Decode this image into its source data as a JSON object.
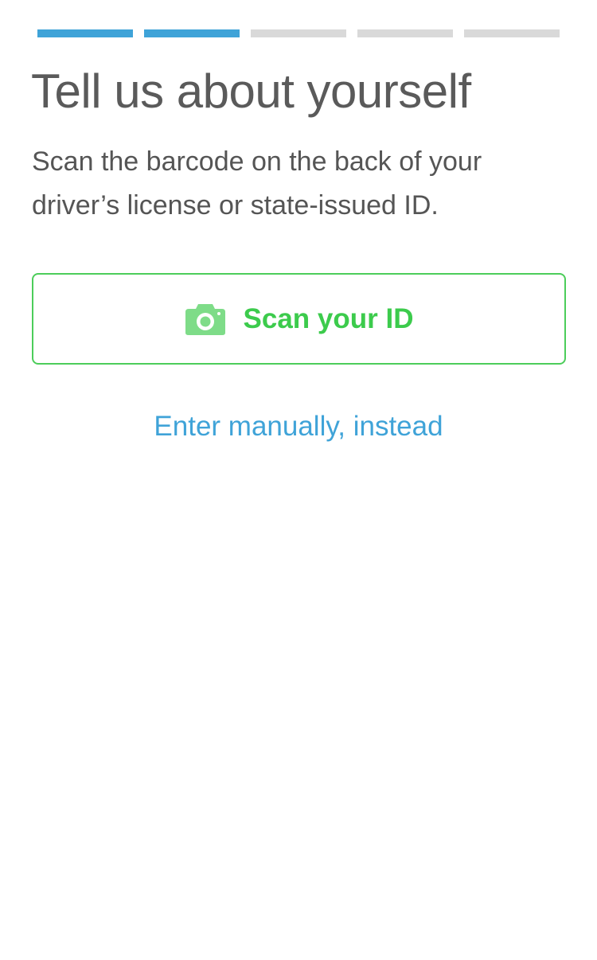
{
  "progress": {
    "total_steps": 5,
    "completed_steps": 2,
    "color_done": "#3fa3d8",
    "color_pending": "#d9d9d9"
  },
  "header": {
    "title": "Tell us about yourself"
  },
  "instructions": {
    "text": "Scan the barcode on the back of your driver’s license or state-issued ID."
  },
  "scan_button": {
    "icon": "camera-icon",
    "label": "Scan your ID",
    "accent_color": "#3ccb4c"
  },
  "manual_entry": {
    "label": "Enter manually, instead",
    "link_color": "#3fa3d8"
  }
}
